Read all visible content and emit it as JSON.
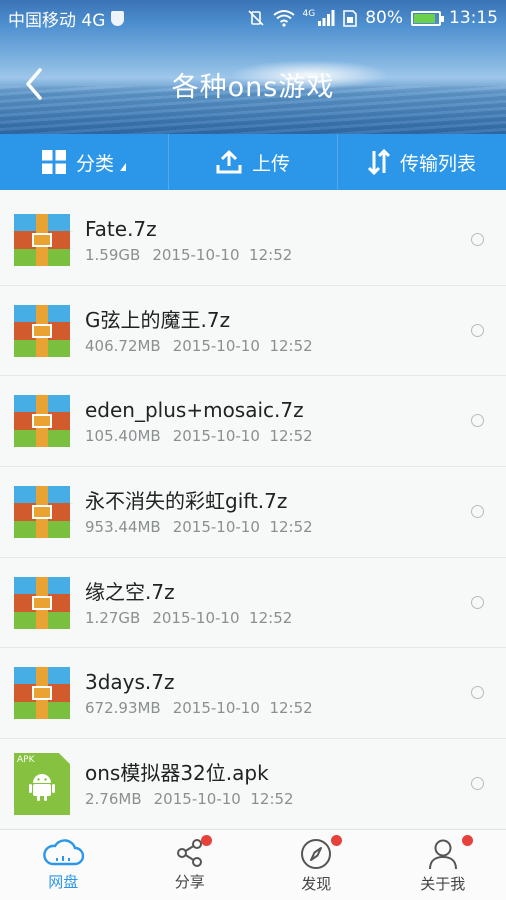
{
  "status_bar": {
    "carrier": "中国移动 4G",
    "network_label": "4G",
    "battery": "80%",
    "time": "13:15"
  },
  "header": {
    "title": "各种ons游戏"
  },
  "toolbar": {
    "category_label": "分类",
    "upload_label": "上传",
    "transfer_label": "传输列表"
  },
  "files": [
    {
      "name": "Fate.7z",
      "size": "1.59GB",
      "date": "2015-10-10",
      "time": "12:52",
      "icon": "zip-archive-icon"
    },
    {
      "name": "G弦上的魔王.7z",
      "size": "406.72MB",
      "date": "2015-10-10",
      "time": "12:52",
      "icon": "zip-archive-icon"
    },
    {
      "name": "eden_plus+mosaic.7z",
      "size": "105.40MB",
      "date": "2015-10-10",
      "time": "12:52",
      "icon": "zip-archive-icon"
    },
    {
      "name": "永不消失的彩虹gift.7z",
      "size": "953.44MB",
      "date": "2015-10-10",
      "time": "12:52",
      "icon": "zip-archive-icon"
    },
    {
      "name": "缘之空.7z",
      "size": "1.27GB",
      "date": "2015-10-10",
      "time": "12:52",
      "icon": "zip-archive-icon"
    },
    {
      "name": "3days.7z",
      "size": "672.93MB",
      "date": "2015-10-10",
      "time": "12:52",
      "icon": "zip-archive-icon"
    },
    {
      "name": "ons模拟器32位.apk",
      "size": "2.76MB",
      "date": "2015-10-10",
      "time": "12:52",
      "icon": "apk-file-icon",
      "tag": "APK"
    }
  ],
  "bottom_nav": [
    {
      "label": "网盘",
      "icon": "cloud-icon",
      "active": true
    },
    {
      "label": "分享",
      "icon": "share-icon",
      "badge": true
    },
    {
      "label": "发现",
      "icon": "compass-icon",
      "badge": true
    },
    {
      "label": "关于我",
      "icon": "user-icon",
      "badge": true
    }
  ],
  "colors": {
    "accent": "#2c97e8",
    "badge": "#e8413b"
  }
}
